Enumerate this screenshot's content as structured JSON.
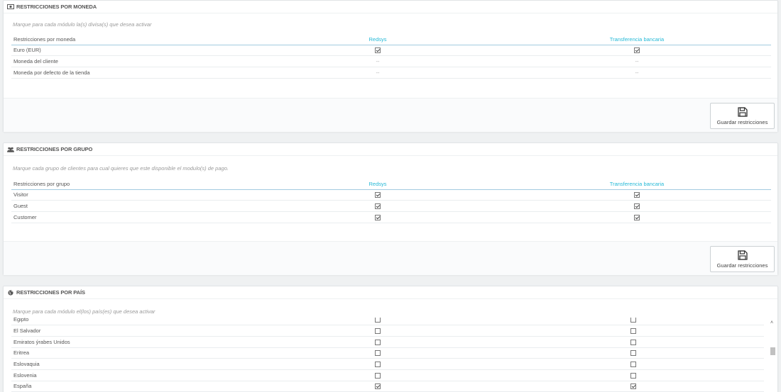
{
  "currency_panel": {
    "title": "RESTRICCIONES POR MONEDA",
    "help": "Marque para cada módulo la(s) divisa(s) que desea activar",
    "col_label": "Restricciones por moneda",
    "modules": [
      "Redsys",
      "Transferencia bancaria"
    ],
    "rows": [
      {
        "label": "Euro (EUR)",
        "values": [
          "checked",
          "checked"
        ]
      },
      {
        "label": "Moneda del cliente",
        "values": [
          "--",
          "--"
        ]
      },
      {
        "label": "Moneda por defecto de la tienda",
        "values": [
          "--",
          "--"
        ]
      }
    ],
    "save_label": "Guardar restricciones"
  },
  "group_panel": {
    "title": "RESTRICCIONES POR GRUPO",
    "help": "Marque cada grupo de clientes para cual quieres que este disponible el modulo(s) de pago.",
    "col_label": "Restricciones por grupo",
    "modules": [
      "Redsys",
      "Transferencia bancaria"
    ],
    "rows": [
      {
        "label": "Visitor",
        "values": [
          "checked",
          "checked"
        ]
      },
      {
        "label": "Guest",
        "values": [
          "checked",
          "checked"
        ]
      },
      {
        "label": "Customer",
        "values": [
          "checked",
          "checked"
        ]
      }
    ],
    "save_label": "Guardar restricciones"
  },
  "country_panel": {
    "title": "RESTRICCIONES POR PAÍS",
    "help": "Marque para cada módulo el(los) país(es) que desea activar",
    "rows": [
      {
        "label": "Egipto",
        "values": [
          "unchecked",
          "unchecked"
        ]
      },
      {
        "label": "El Salvador",
        "values": [
          "unchecked",
          "unchecked"
        ]
      },
      {
        "label": "Emiratos ýrabes Unidos",
        "values": [
          "unchecked",
          "unchecked"
        ]
      },
      {
        "label": "Eritrea",
        "values": [
          "unchecked",
          "unchecked"
        ]
      },
      {
        "label": "Eslovaquia",
        "values": [
          "unchecked",
          "unchecked"
        ]
      },
      {
        "label": "Eslovenia",
        "values": [
          "unchecked",
          "unchecked"
        ]
      },
      {
        "label": "España",
        "values": [
          "checked",
          "checked"
        ]
      }
    ]
  },
  "icons": {
    "currency": "money-icon",
    "group": "users-icon",
    "country": "globe-icon",
    "save": "floppy-disk-icon",
    "scroll_up": "chevron-up-icon"
  },
  "colors": {
    "accent": "#25b9d7",
    "background": "#eff1f2"
  }
}
